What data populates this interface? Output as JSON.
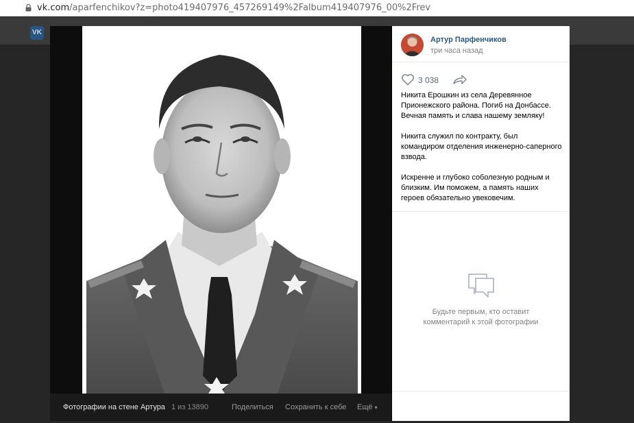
{
  "browser": {
    "url_host": "vk.com",
    "url_rest": "/aparfenchikov?z=photo419407976_457269149%2Falbum419407976_00%2Frev"
  },
  "site": {
    "logo_text": "VK"
  },
  "photo_footer": {
    "album": "Фотографии на стене Артура",
    "count": "1 из 13890",
    "share": "Поделиться",
    "save": "Сохранить к себе",
    "more": "Ещё"
  },
  "post": {
    "author": "Артур Парфенчиков",
    "time": "три часа назад",
    "likes": "3 038",
    "text": "Никита Ерошкин из села Деревянное Прионежского района. Погиб на Донбассе. Вечная память и слава нашему земляку!\n\nНикита служил по контракту, был командиром отделения инженерно-саперного взвода.\n\nИскренне и глубоко соболезную родным и близким. Им поможем, а память наших героев обязательно увековечим."
  },
  "comments": {
    "empty_text": "Будьте первым, кто оставит\nкомментарий к этой фотографии"
  },
  "colors": {
    "link": "#2a5885",
    "muted": "#828282"
  },
  "icons": {
    "lock": "lock-icon",
    "like": "heart-icon",
    "share": "share-arrow-icon",
    "comment": "speech-bubble-icon",
    "more": "chevron-down-icon"
  }
}
